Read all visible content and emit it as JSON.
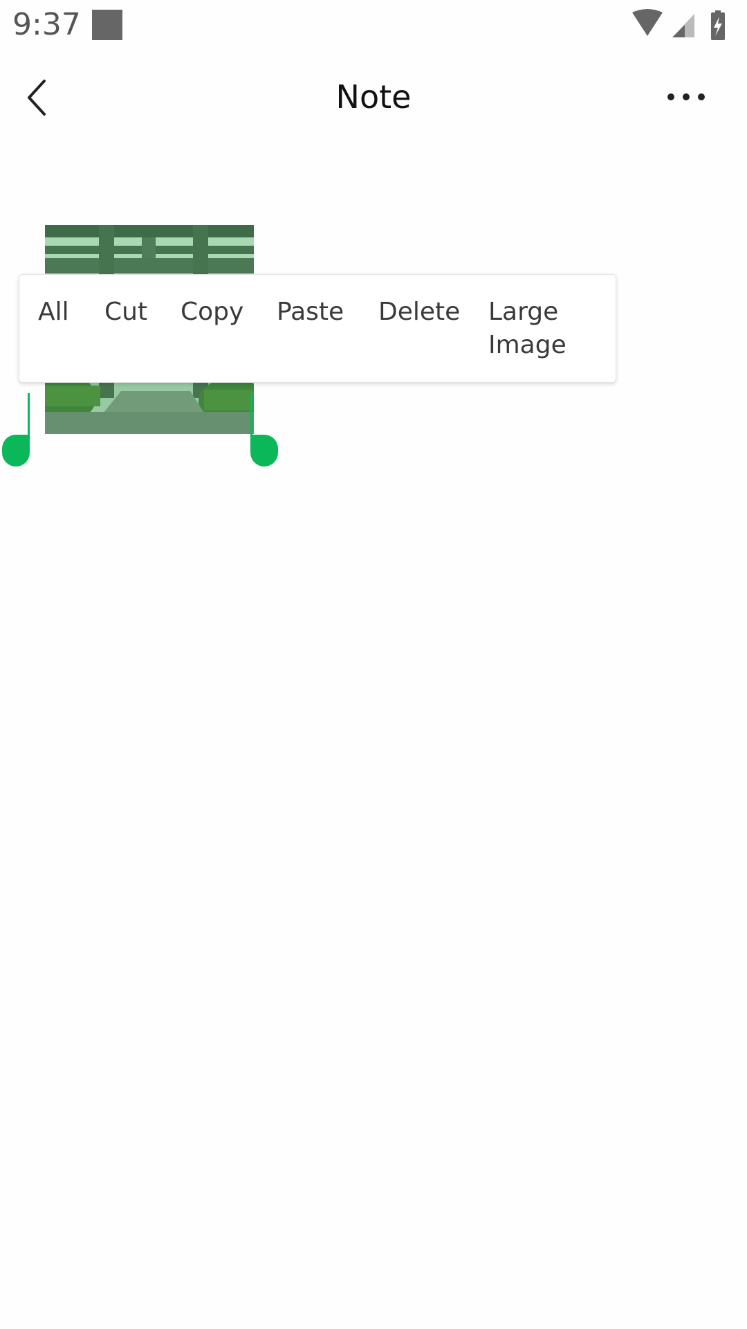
{
  "status_bar": {
    "time": "9:37",
    "icons": [
      "notification-square-icon",
      "wifi-icon",
      "signal-icon",
      "battery-charging-icon"
    ]
  },
  "header": {
    "title": "Note",
    "back_icon": "chevron-left-icon",
    "more_icon": "more-horizontal-icon"
  },
  "context_menu": {
    "items": [
      "All",
      "Cut",
      "Copy",
      "Paste",
      "Delete",
      "Large Image"
    ]
  },
  "colors": {
    "accent": "#0ab85a"
  }
}
